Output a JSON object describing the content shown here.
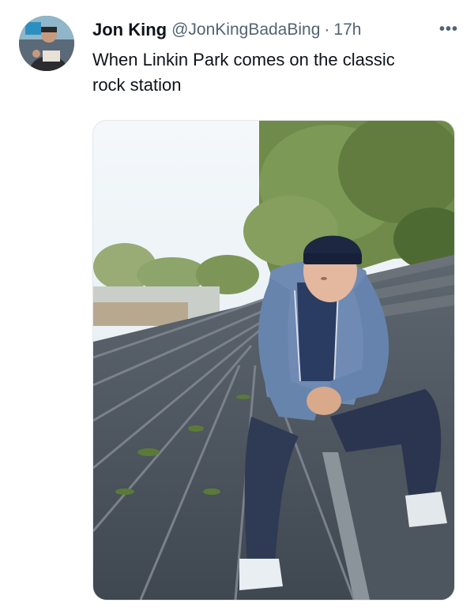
{
  "tweet": {
    "author_name": "Jon King",
    "author_handle": "@JonKingBadaBing",
    "separator": "·",
    "timestamp": "17h",
    "more_icon": "more-horizontal-icon",
    "text": "When Linkin Park comes on the classic rock station",
    "avatar_icon": "user-avatar",
    "media": {
      "type": "photo"
    }
  }
}
